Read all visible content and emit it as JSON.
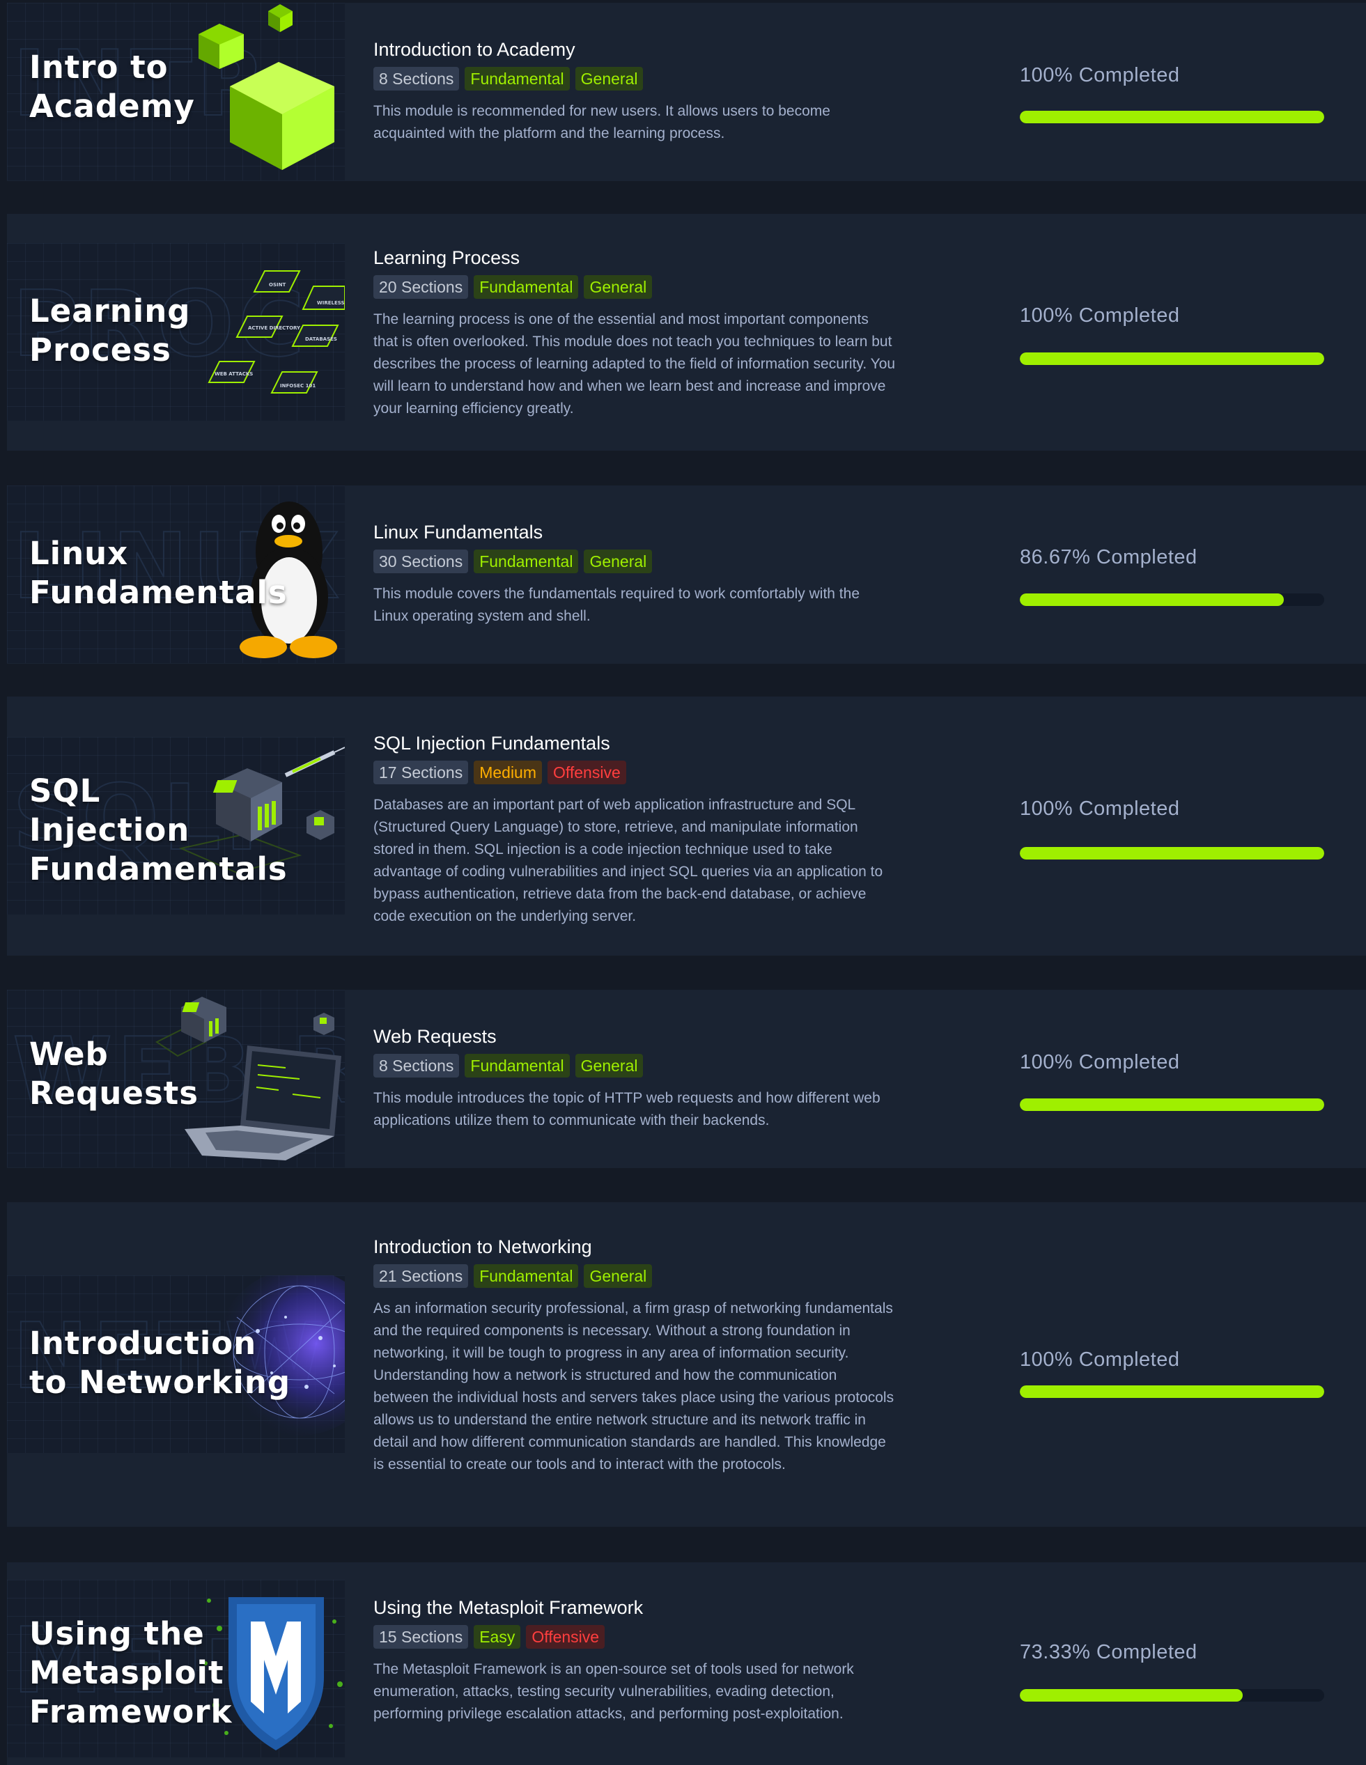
{
  "modules": [
    {
      "banner_title": "Intro to\nAcademy",
      "title": "Introduction to Academy",
      "sections": "8 Sections",
      "difficulty": "Fundamental",
      "category": "General",
      "description": "This module is recommended for new users. It allows users to become acquainted with the platform and the learning process.",
      "progress_label": "100% Completed",
      "progress_percent": 100
    },
    {
      "banner_title": "Learning\nProcess",
      "title": "Learning Process",
      "sections": "20 Sections",
      "difficulty": "Fundamental",
      "category": "General",
      "description": "The learning process is one of the essential and most important components that is often overlooked. This module does not teach you techniques to learn but describes the process of learning adapted to the field of information security. You will learn to understand how and when we learn best and increase and improve your learning efficiency greatly.",
      "progress_label": "100% Completed",
      "progress_percent": 100,
      "art_labels": [
        "OSINT",
        "WIRELESS",
        "ACTIVE DIRECTORY",
        "DATABASES",
        "WEB ATTACKS",
        "INFOSEC 101"
      ]
    },
    {
      "banner_title": "Linux\nFundamentals",
      "title": "Linux Fundamentals",
      "sections": "30 Sections",
      "difficulty": "Fundamental",
      "category": "General",
      "description": "This module covers the fundamentals required to work comfortably with the Linux operating system and shell.",
      "progress_label": "86.67% Completed",
      "progress_percent": 86.67
    },
    {
      "banner_title": "SQL\nInjection\nFundamentals",
      "title": "SQL Injection Fundamentals",
      "sections": "17 Sections",
      "difficulty": "Medium",
      "category": "Offensive",
      "description": "Databases are an important part of web application infrastructure and SQL (Structured Query Language) to store, retrieve, and manipulate information stored in them. SQL injection is a code injection technique used to take advantage of coding vulnerabilities and inject SQL queries via an application to bypass authentication, retrieve data from the back-end database, or achieve code execution on the underlying server.",
      "progress_label": "100% Completed",
      "progress_percent": 100
    },
    {
      "banner_title": "Web\nRequests",
      "title": "Web Requests",
      "sections": "8 Sections",
      "difficulty": "Fundamental",
      "category": "General",
      "description": "This module introduces the topic of HTTP web requests and how different web applications utilize them to communicate with their backends.",
      "progress_label": "100% Completed",
      "progress_percent": 100
    },
    {
      "banner_title": "Introduction\nto Networking",
      "title": "Introduction to Networking",
      "sections": "21 Sections",
      "difficulty": "Fundamental",
      "category": "General",
      "description": "As an information security professional, a firm grasp of networking fundamentals and the required components is necessary. Without a strong foundation in networking, it will be tough to progress in any area of information security. Understanding how a network is structured and how the communication between the individual hosts and servers takes place using the various protocols allows us to understand the entire network structure and its network traffic in detail and how different communication standards are handled. This knowledge is essential to create our tools and to interact with the protocols.",
      "progress_label": "100% Completed",
      "progress_percent": 100
    },
    {
      "banner_title": "Using the\nMetasploit\nFramework",
      "title": "Using the Metasploit Framework",
      "sections": "15 Sections",
      "difficulty": "Easy",
      "category": "Offensive",
      "description": "The Metasploit Framework is an open-source set of tools used for network enumeration, attacks, testing security vulnerabilities, evading detection, performing privilege escalation attacks, and performing post-exploitation.",
      "progress_label": "73.33% Completed",
      "progress_percent": 73.33
    }
  ],
  "colors": {
    "accent_green": "#9fef00",
    "medium_orange": "#ffaf00",
    "offensive_red": "#ff3e3e",
    "card_bg": "#1a2332",
    "page_bg": "#141a25"
  }
}
